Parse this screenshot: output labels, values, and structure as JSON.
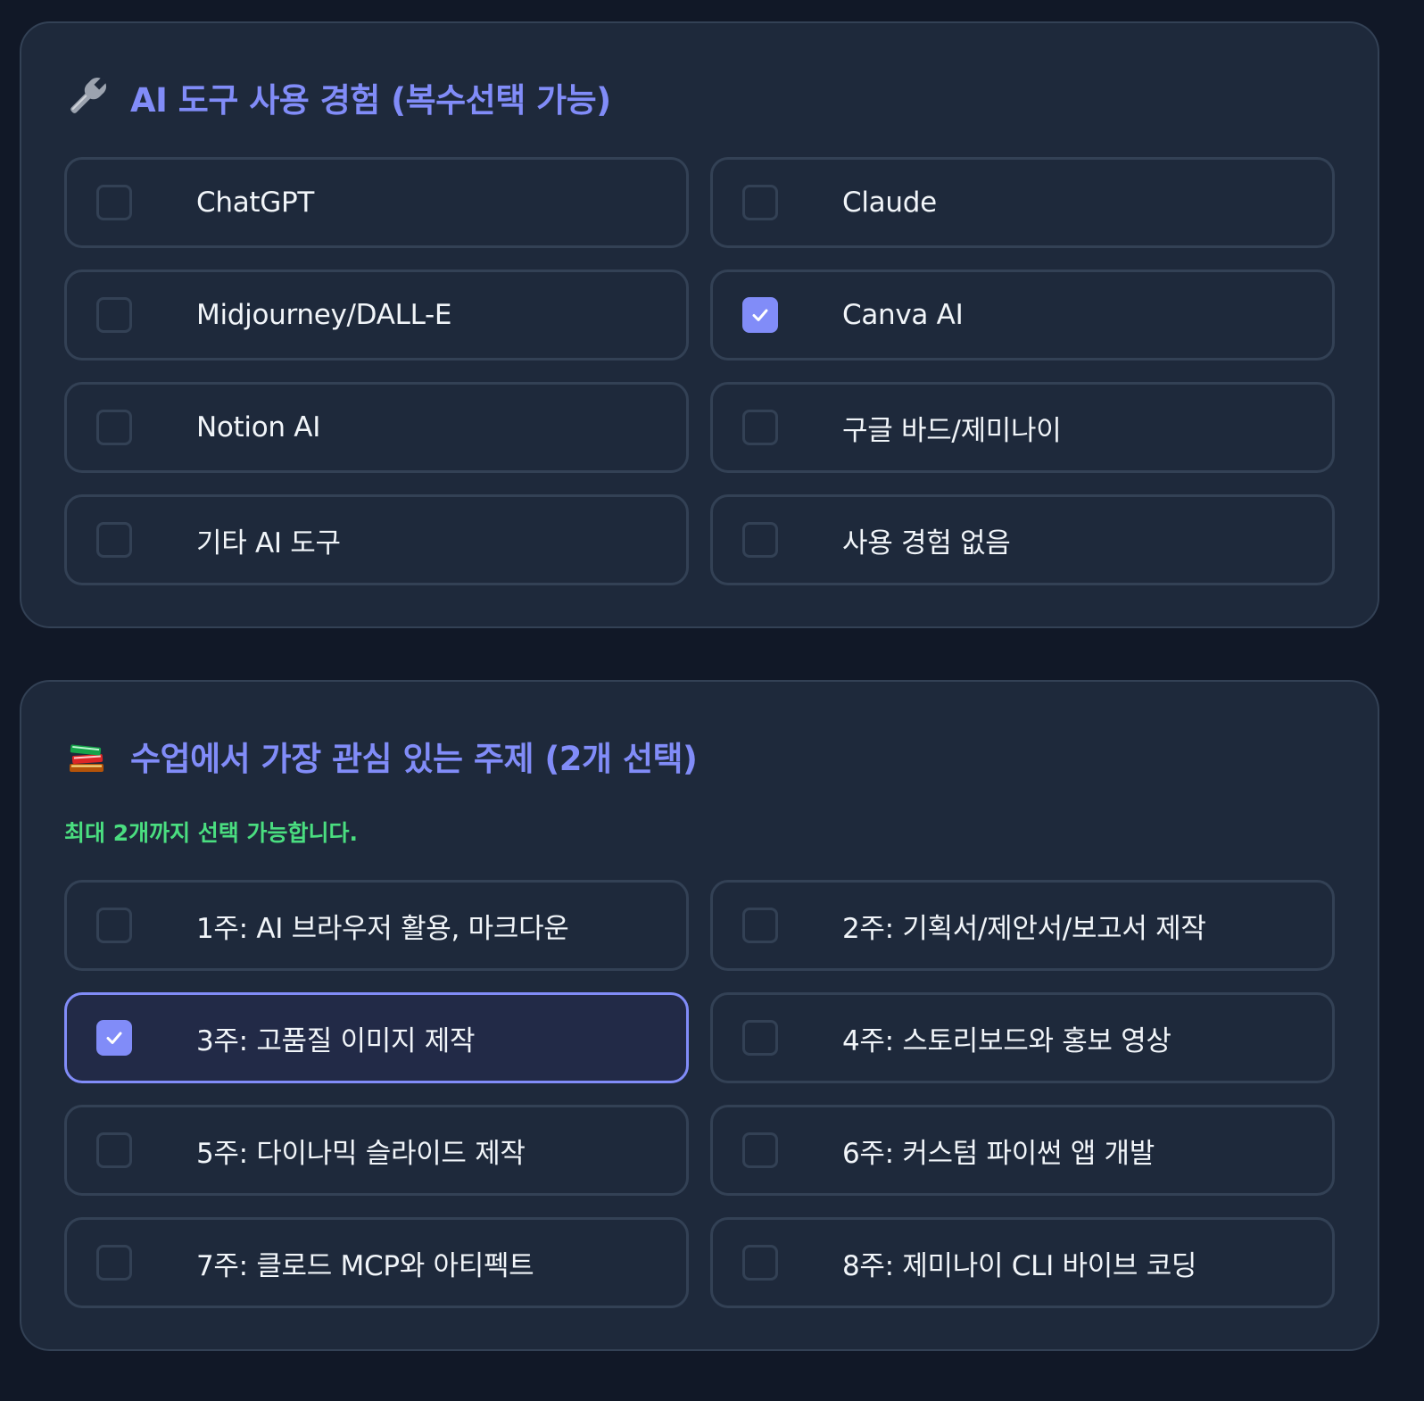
{
  "colors": {
    "page_bg": "#111827",
    "card_bg": "#1e293b",
    "border": "#334155",
    "accent": "#818cf8",
    "hint": "#4ade80",
    "text": "#f1f5f9"
  },
  "tools_section": {
    "icon": "wrench-icon",
    "title": "AI 도구 사용 경험 (복수선택 가능)",
    "options": [
      {
        "label": "ChatGPT",
        "checked": false
      },
      {
        "label": "Claude",
        "checked": false
      },
      {
        "label": "Midjourney/DALL-E",
        "checked": false
      },
      {
        "label": "Canva AI",
        "checked": true
      },
      {
        "label": "Notion AI",
        "checked": false
      },
      {
        "label": "구글 바드/제미나이",
        "checked": false
      },
      {
        "label": "기타 AI 도구",
        "checked": false
      },
      {
        "label": "사용 경험 없음",
        "checked": false
      }
    ]
  },
  "topics_section": {
    "icon": "books-icon",
    "title": "수업에서 가장 관심 있는 주제 (2개 선택)",
    "hint": "최대 2개까지 선택 가능합니다.",
    "options": [
      {
        "label": "1주: AI 브라우저 활용, 마크다운",
        "checked": false
      },
      {
        "label": "2주: 기획서/제안서/보고서 제작",
        "checked": false
      },
      {
        "label": "3주: 고품질 이미지 제작",
        "checked": true
      },
      {
        "label": "4주: 스토리보드와 홍보 영상",
        "checked": false
      },
      {
        "label": "5주: 다이나믹 슬라이드 제작",
        "checked": false
      },
      {
        "label": "6주: 커스텀 파이썬 앱 개발",
        "checked": false
      },
      {
        "label": "7주: 클로드 MCP와 아티펙트",
        "checked": false
      },
      {
        "label": "8주: 제미나이 CLI 바이브 코딩",
        "checked": false
      }
    ]
  }
}
